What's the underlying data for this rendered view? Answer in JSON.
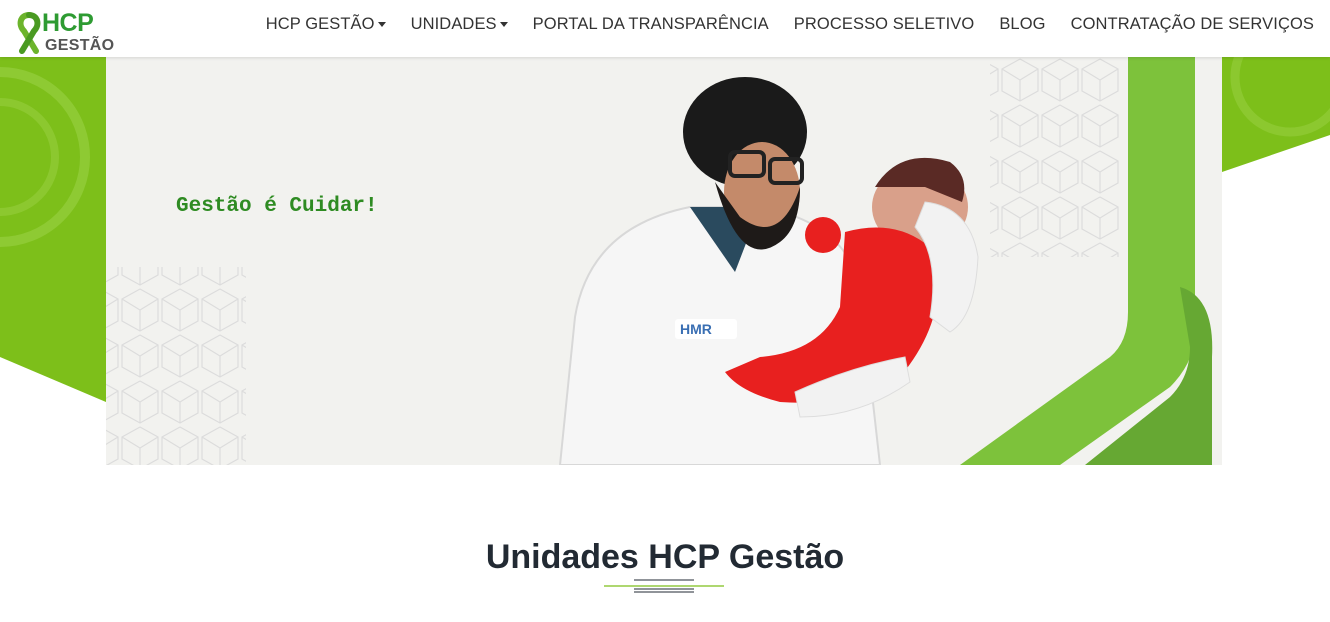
{
  "brand": {
    "logo_top": "HCP",
    "logo_bottom": "GESTÃO"
  },
  "nav": {
    "items": [
      {
        "label": "HCP GESTÃO",
        "dropdown": true
      },
      {
        "label": "UNIDADES",
        "dropdown": true
      },
      {
        "label": "PORTAL DA TRANSPARÊNCIA",
        "dropdown": false
      },
      {
        "label": "PROCESSO SELETIVO",
        "dropdown": false
      },
      {
        "label": "BLOG",
        "dropdown": false
      },
      {
        "label": "CONTRATAÇÃO DE SERVIÇOS",
        "dropdown": false
      }
    ]
  },
  "hero": {
    "slogan": "Gestão é Cuidar!",
    "badge_text": "HMR"
  },
  "section": {
    "title": "Unidades HCP Gestão"
  },
  "colors": {
    "brand_green": "#7dbf1a",
    "dark_green": "#2e8b22",
    "title": "#222a33",
    "baby_outfit": "#e8201f"
  }
}
